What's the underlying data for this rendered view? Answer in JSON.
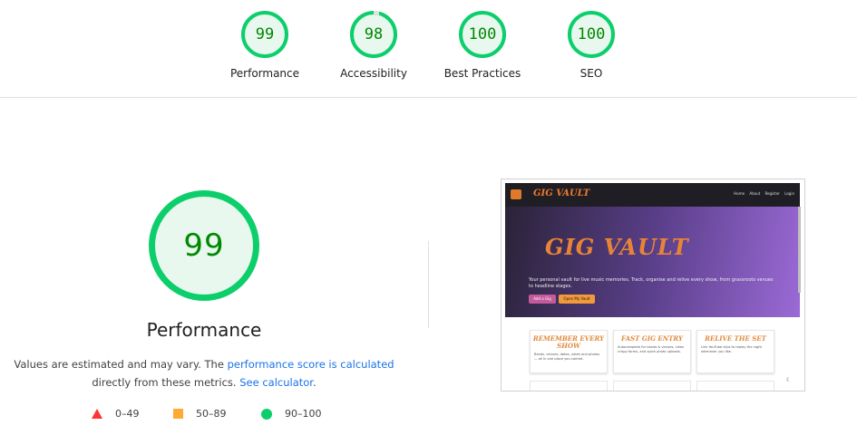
{
  "top_gauges": [
    {
      "score": "99",
      "label": "Performance"
    },
    {
      "score": "98",
      "label": "Accessibility"
    },
    {
      "score": "100",
      "label": "Best Practices"
    },
    {
      "score": "100",
      "label": "SEO"
    }
  ],
  "main": {
    "score": "99",
    "title": "Performance",
    "desc_prefix": "Values are estimated and may vary. The ",
    "desc_link1": "performance score is calculated",
    "desc_middle": "directly from these metrics. ",
    "desc_link2": "See calculator",
    "desc_suffix": "."
  },
  "legend": {
    "fail": "0–49",
    "average": "50–89",
    "pass": "90–100"
  },
  "colors": {
    "pass": "#0cce6b",
    "average": "#ffaa33",
    "fail": "#ff3333",
    "link": "#1a73e8"
  },
  "thumbnail": {
    "logo": "GIG VAULT",
    "nav": [
      "Home",
      "About",
      "Register",
      "Login"
    ],
    "hero_title": "GIG VAULT",
    "hero_sub": "Your personal vault for live music memories. Track, organise and relive every show, from grassroots venues to headline stages.",
    "btn_add": "Add a Gig",
    "btn_open": "Open My Vault",
    "cards": [
      {
        "title": "REMEMBER EVERY SHOW",
        "text": "Bands, venues, dates, notes and photos — all in one place you control."
      },
      {
        "title": "FAST GIG ENTRY",
        "text": "Autocomplete for bands & venues, clean crispy forms, and quick photo uploads."
      },
      {
        "title": "RELIVE THE SET",
        "text": "Link YouTube clips to replay the night whenever you like."
      }
    ],
    "moon": "☾"
  }
}
